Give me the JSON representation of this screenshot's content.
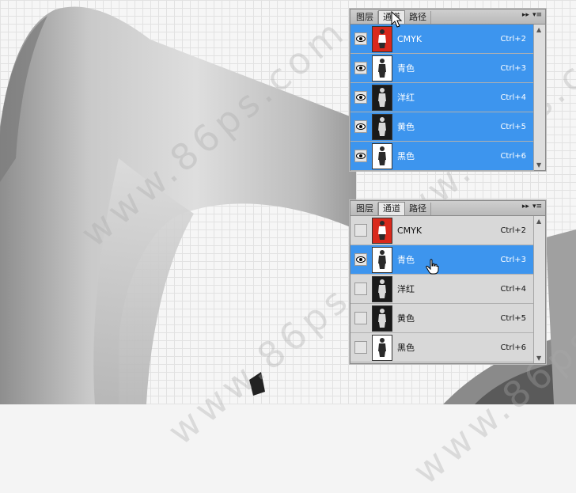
{
  "panel_top": {
    "tabs": [
      "图层",
      "通道",
      "路径"
    ],
    "active_tab": 1,
    "channels": [
      {
        "name": "CMYK",
        "shortcut": "Ctrl+2",
        "selected": true,
        "visible": true,
        "thumb": "red"
      },
      {
        "name": "青色",
        "shortcut": "Ctrl+3",
        "selected": true,
        "visible": true,
        "thumb": "white"
      },
      {
        "name": "洋红",
        "shortcut": "Ctrl+4",
        "selected": true,
        "visible": true,
        "thumb": "dark"
      },
      {
        "name": "黄色",
        "shortcut": "Ctrl+5",
        "selected": true,
        "visible": true,
        "thumb": "dark"
      },
      {
        "name": "黑色",
        "shortcut": "Ctrl+6",
        "selected": true,
        "visible": true,
        "thumb": "white"
      }
    ]
  },
  "panel_bottom": {
    "tabs": [
      "图层",
      "通道",
      "路径"
    ],
    "active_tab": 1,
    "channels": [
      {
        "name": "CMYK",
        "shortcut": "Ctrl+2",
        "selected": false,
        "visible": false,
        "thumb": "red"
      },
      {
        "name": "青色",
        "shortcut": "Ctrl+3",
        "selected": true,
        "visible": true,
        "thumb": "white"
      },
      {
        "name": "洋红",
        "shortcut": "Ctrl+4",
        "selected": false,
        "visible": false,
        "thumb": "dark"
      },
      {
        "name": "黄色",
        "shortcut": "Ctrl+5",
        "selected": false,
        "visible": false,
        "thumb": "dark"
      },
      {
        "name": "黑色",
        "shortcut": "Ctrl+6",
        "selected": false,
        "visible": false,
        "thumb": "white"
      }
    ]
  },
  "colors": {
    "selection": "#3d95ee",
    "panel_bg": "#d8d8d8"
  },
  "icons": {
    "visibility": "eye-icon",
    "panel_menu": "panel-menu-icon",
    "collapse": "double-arrow-icon"
  },
  "watermark": "www.86ps.com"
}
